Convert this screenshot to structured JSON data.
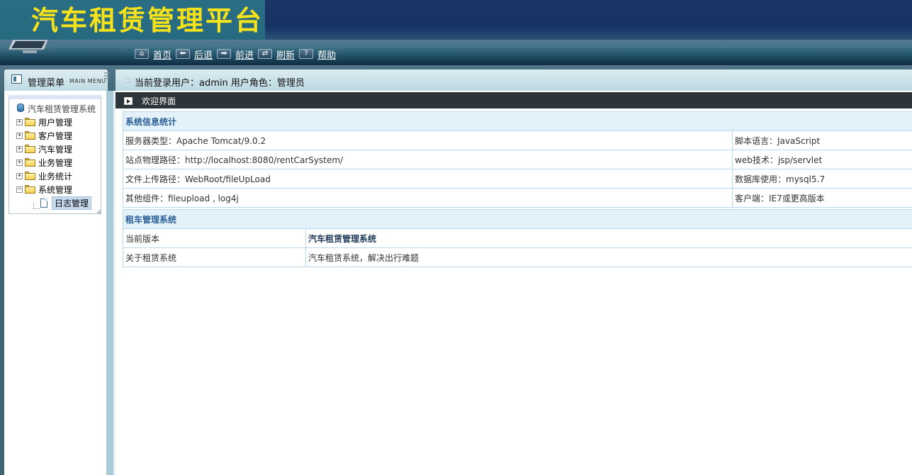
{
  "header": {
    "title": "汽车租赁管理平台",
    "nav": [
      {
        "icon": "home-icon",
        "glyph": "⌂",
        "label": "首页"
      },
      {
        "icon": "back-arrow-icon",
        "glyph": "⬅",
        "label": "后退"
      },
      {
        "icon": "forward-arrow-icon",
        "glyph": "➡",
        "label": "前进"
      },
      {
        "icon": "refresh-icon",
        "glyph": "⇄",
        "label": "刷新"
      },
      {
        "icon": "help-icon",
        "glyph": "?",
        "label": "帮助"
      }
    ]
  },
  "subbar": {
    "menu_title": "管理菜单",
    "menu_sub": "MAIN MENU",
    "user_info": "当前登录用户：admin  用户角色：管理员"
  },
  "sidebar": {
    "root": "汽车租赁管理系统",
    "items": [
      {
        "label": "用户管理",
        "expander": "+"
      },
      {
        "label": "客户管理",
        "expander": "+"
      },
      {
        "label": "汽车管理",
        "expander": "+"
      },
      {
        "label": "业务管理",
        "expander": "+"
      },
      {
        "label": "业务统计",
        "expander": "+"
      },
      {
        "label": "系统管理",
        "expander": "−"
      }
    ],
    "leaf": "日志管理"
  },
  "main": {
    "welcome": "欢迎界面",
    "system_info": {
      "heading": "系统信息统计",
      "rows": [
        {
          "left": "服务器类型：Apache Tomcat/9.0.2",
          "right": "脚本语言：JavaScript"
        },
        {
          "left": "站点物理路径：http://localhost:8080/rentCarSystem/",
          "right": "web技术：jsp/servlet"
        },
        {
          "left": "文件上传路径：WebRoot/fileUpLoad",
          "right": "数据库使用：mysql5.7"
        },
        {
          "left": "其他组件：fileupload , log4j",
          "right": "客户端：IE7或更高版本"
        }
      ]
    },
    "rent_info": {
      "heading": "租车管理系统",
      "rows": [
        {
          "label": "当前版本",
          "value": "汽车租赁管理系统"
        },
        {
          "label": "关于租赁系统",
          "value": "汽车租赁系统，解决出行难题"
        }
      ]
    }
  }
}
